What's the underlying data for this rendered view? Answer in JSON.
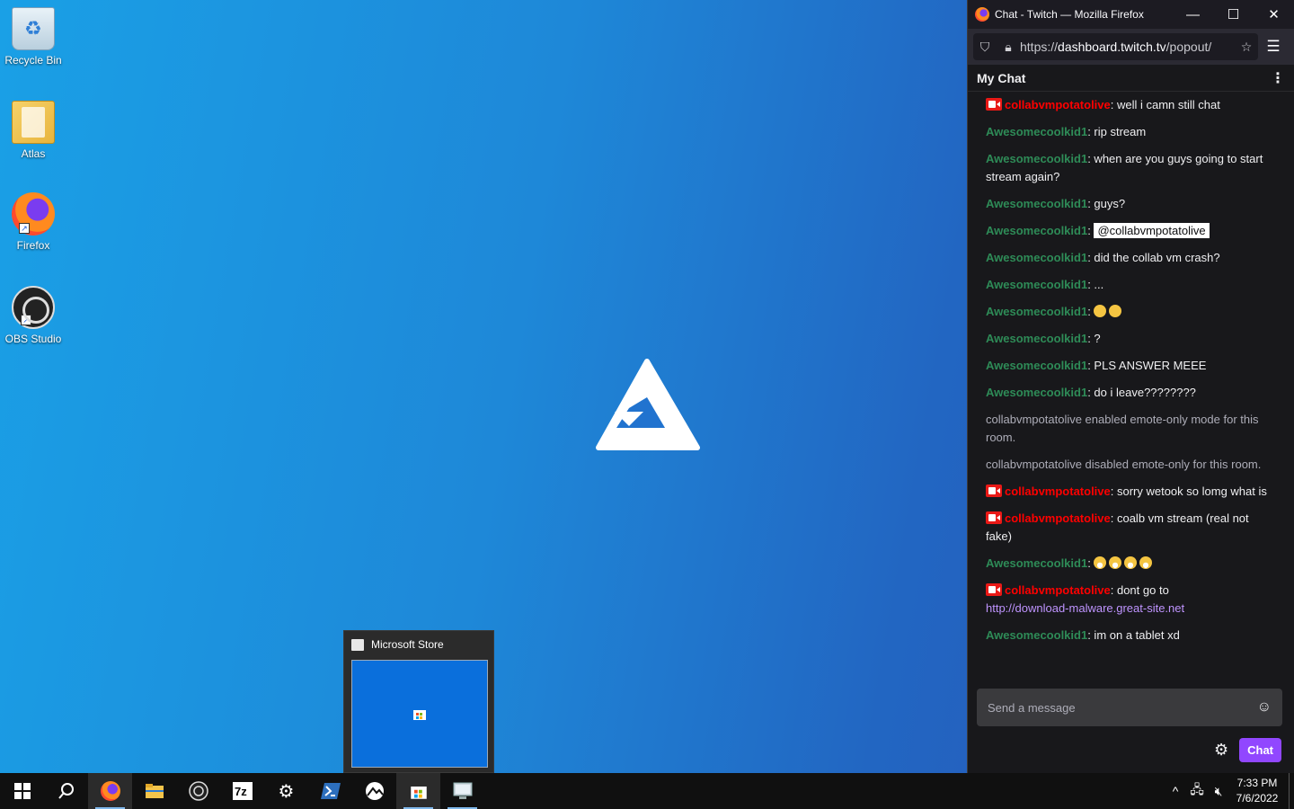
{
  "desktop": {
    "icons": [
      {
        "label": "Recycle Bin"
      },
      {
        "label": "Atlas"
      },
      {
        "label": "Firefox"
      },
      {
        "label": "OBS Studio"
      }
    ]
  },
  "taskbar": {
    "clock_time": "7:33 PM",
    "clock_date": "7/6/2022",
    "preview_title": "Microsoft Store"
  },
  "firefox": {
    "window_title": "Chat - Twitch — Mozilla Firefox",
    "url_prefix": "https://",
    "url_host": "dashboard.twitch.tv",
    "url_rest": "/popout/",
    "chat_header": "My Chat",
    "input_placeholder": "Send a message",
    "chat_button": "Chat",
    "messages": [
      {
        "type": "user",
        "badge": true,
        "user": "collabvmpotatolive",
        "color": "red",
        "text": ": well i camn still chat"
      },
      {
        "type": "user",
        "badge": false,
        "user": "Awesomecoolkid1",
        "color": "green",
        "text": ": rip stream"
      },
      {
        "type": "user",
        "badge": false,
        "user": "Awesomecoolkid1",
        "color": "green",
        "text": ": when are you guys going to start stream again?"
      },
      {
        "type": "user",
        "badge": false,
        "user": "Awesomecoolkid1",
        "color": "green",
        "text": ": guys?"
      },
      {
        "type": "mention",
        "badge": false,
        "user": "Awesomecoolkid1",
        "color": "green",
        "text": ": ",
        "mention": "@collabvmpotatolive"
      },
      {
        "type": "user",
        "badge": false,
        "user": "Awesomecoolkid1",
        "color": "green",
        "text": ": did the collab vm crash?"
      },
      {
        "type": "user",
        "badge": false,
        "user": "Awesomecoolkid1",
        "color": "green",
        "text": ": ..."
      },
      {
        "type": "emoji",
        "badge": false,
        "user": "Awesomecoolkid1",
        "color": "green",
        "text": ": ",
        "emojis": [
          "neutral-face-emoji",
          "neutral-face-emoji"
        ]
      },
      {
        "type": "user",
        "badge": false,
        "user": "Awesomecoolkid1",
        "color": "green",
        "text": ": ?"
      },
      {
        "type": "user",
        "badge": false,
        "user": "Awesomecoolkid1",
        "color": "green",
        "text": ": PLS ANSWER MEEE"
      },
      {
        "type": "user",
        "badge": false,
        "user": "Awesomecoolkid1",
        "color": "green",
        "text": ": do i leave????????"
      },
      {
        "type": "system",
        "text": "collabvmpotatolive enabled emote-only mode for this room."
      },
      {
        "type": "system",
        "text": "collabvmpotatolive disabled emote-only for this room."
      },
      {
        "type": "user",
        "badge": true,
        "user": "collabvmpotatolive",
        "color": "red",
        "text": ": sorry wetook so lomg what is"
      },
      {
        "type": "user",
        "badge": true,
        "user": "collabvmpotatolive",
        "color": "red",
        "text": ": coalb vm stream (real not fake)"
      },
      {
        "type": "emoji",
        "badge": false,
        "user": "Awesomecoolkid1",
        "color": "green",
        "text": ": ",
        "emojis": [
          "laughing-emoji",
          "laughing-emoji",
          "laughing-emoji",
          "laughing-emoji"
        ]
      },
      {
        "type": "link",
        "badge": true,
        "user": "collabvmpotatolive",
        "color": "red",
        "text": ": dont go to ",
        "link": "http://download-malware.great-site.net"
      },
      {
        "type": "user",
        "badge": false,
        "user": "Awesomecoolkid1",
        "color": "green",
        "text": ": im on a tablet xd"
      }
    ]
  },
  "colors": {
    "twitch_purple": "#9147ff",
    "username_green": "#2e8b57",
    "username_red": "#ff0000",
    "broadcaster_badge": "#e91916"
  }
}
